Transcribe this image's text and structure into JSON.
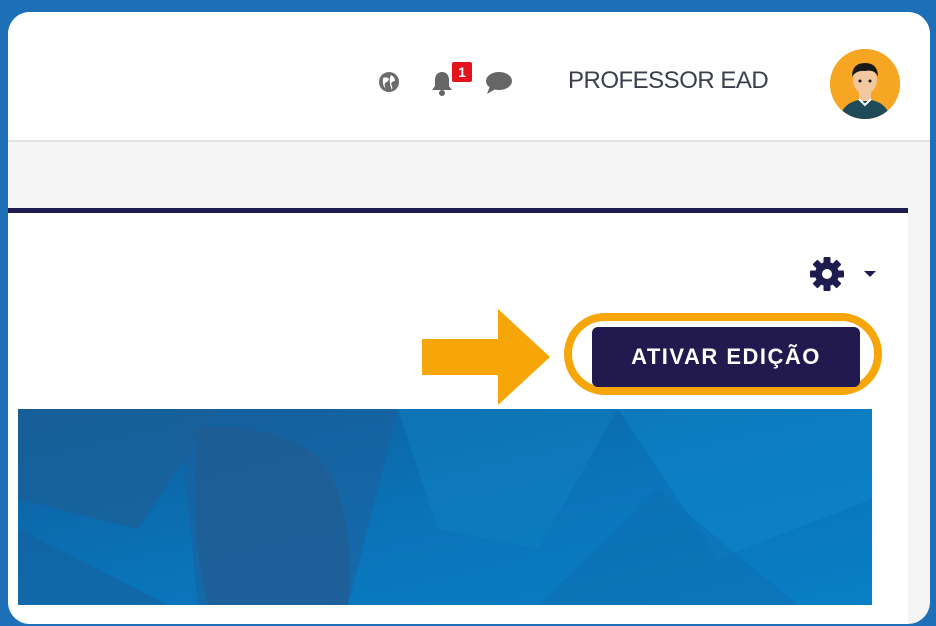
{
  "header": {
    "language_icon": "globe-icon",
    "notifications_icon": "bell-icon",
    "notification_count": "1",
    "messages_icon": "chat-icon",
    "user_name": "PROFESSOR EAD",
    "avatar_icon": "user-avatar"
  },
  "page": {
    "settings_icon": "gear-icon",
    "edit_button_label": "ATIVAR EDIÇÃO",
    "callout_arrow_icon": "arrow-right-icon"
  },
  "colors": {
    "brand_dark": "#22194f",
    "highlight": "#f6a608",
    "badge": "#e3141b",
    "outer_border": "#1d6fb8"
  }
}
